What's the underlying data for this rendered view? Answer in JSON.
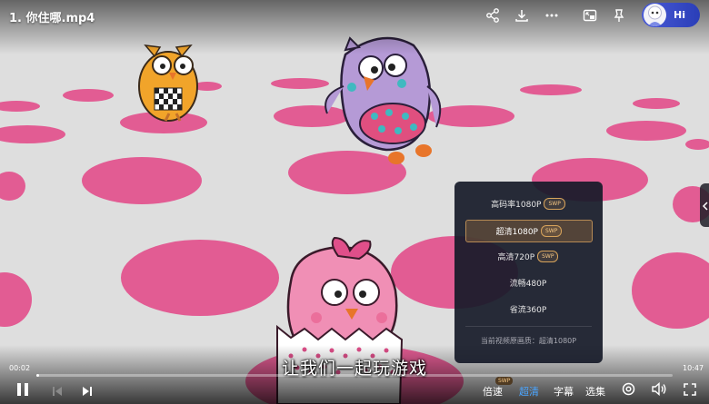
{
  "player": {
    "title": "1. 你住哪.mp4",
    "hi_label": "Hi",
    "subtitle": "让我们一起玩游戏",
    "current_time": "00:02",
    "duration": "10:47",
    "progress": 0.004
  },
  "top_icons": [
    "share-icon",
    "download-icon",
    "more-icon",
    "picture-in-picture-icon",
    "pin-icon"
  ],
  "quality_menu": {
    "items": [
      {
        "label": "高码率1080P",
        "badge": "SWP",
        "selected": false
      },
      {
        "label": "超清1080P",
        "badge": "SWP",
        "selected": true
      },
      {
        "label": "高清720P",
        "badge": "SWP",
        "selected": false
      },
      {
        "label": "流畅480P",
        "badge": "",
        "selected": false
      },
      {
        "label": "省流360P",
        "badge": "",
        "selected": false
      }
    ],
    "current": "当前视频原画质：超清1080P"
  },
  "controls": {
    "speed_label": "倍速",
    "speed_badge": "SWP",
    "quality_label": "超清",
    "caption_label": "字幕",
    "episodes_label": "选集"
  },
  "colors": {
    "accent": "#4aa5ff",
    "floor": "#dcdcdc",
    "spot": "#e0508a"
  }
}
